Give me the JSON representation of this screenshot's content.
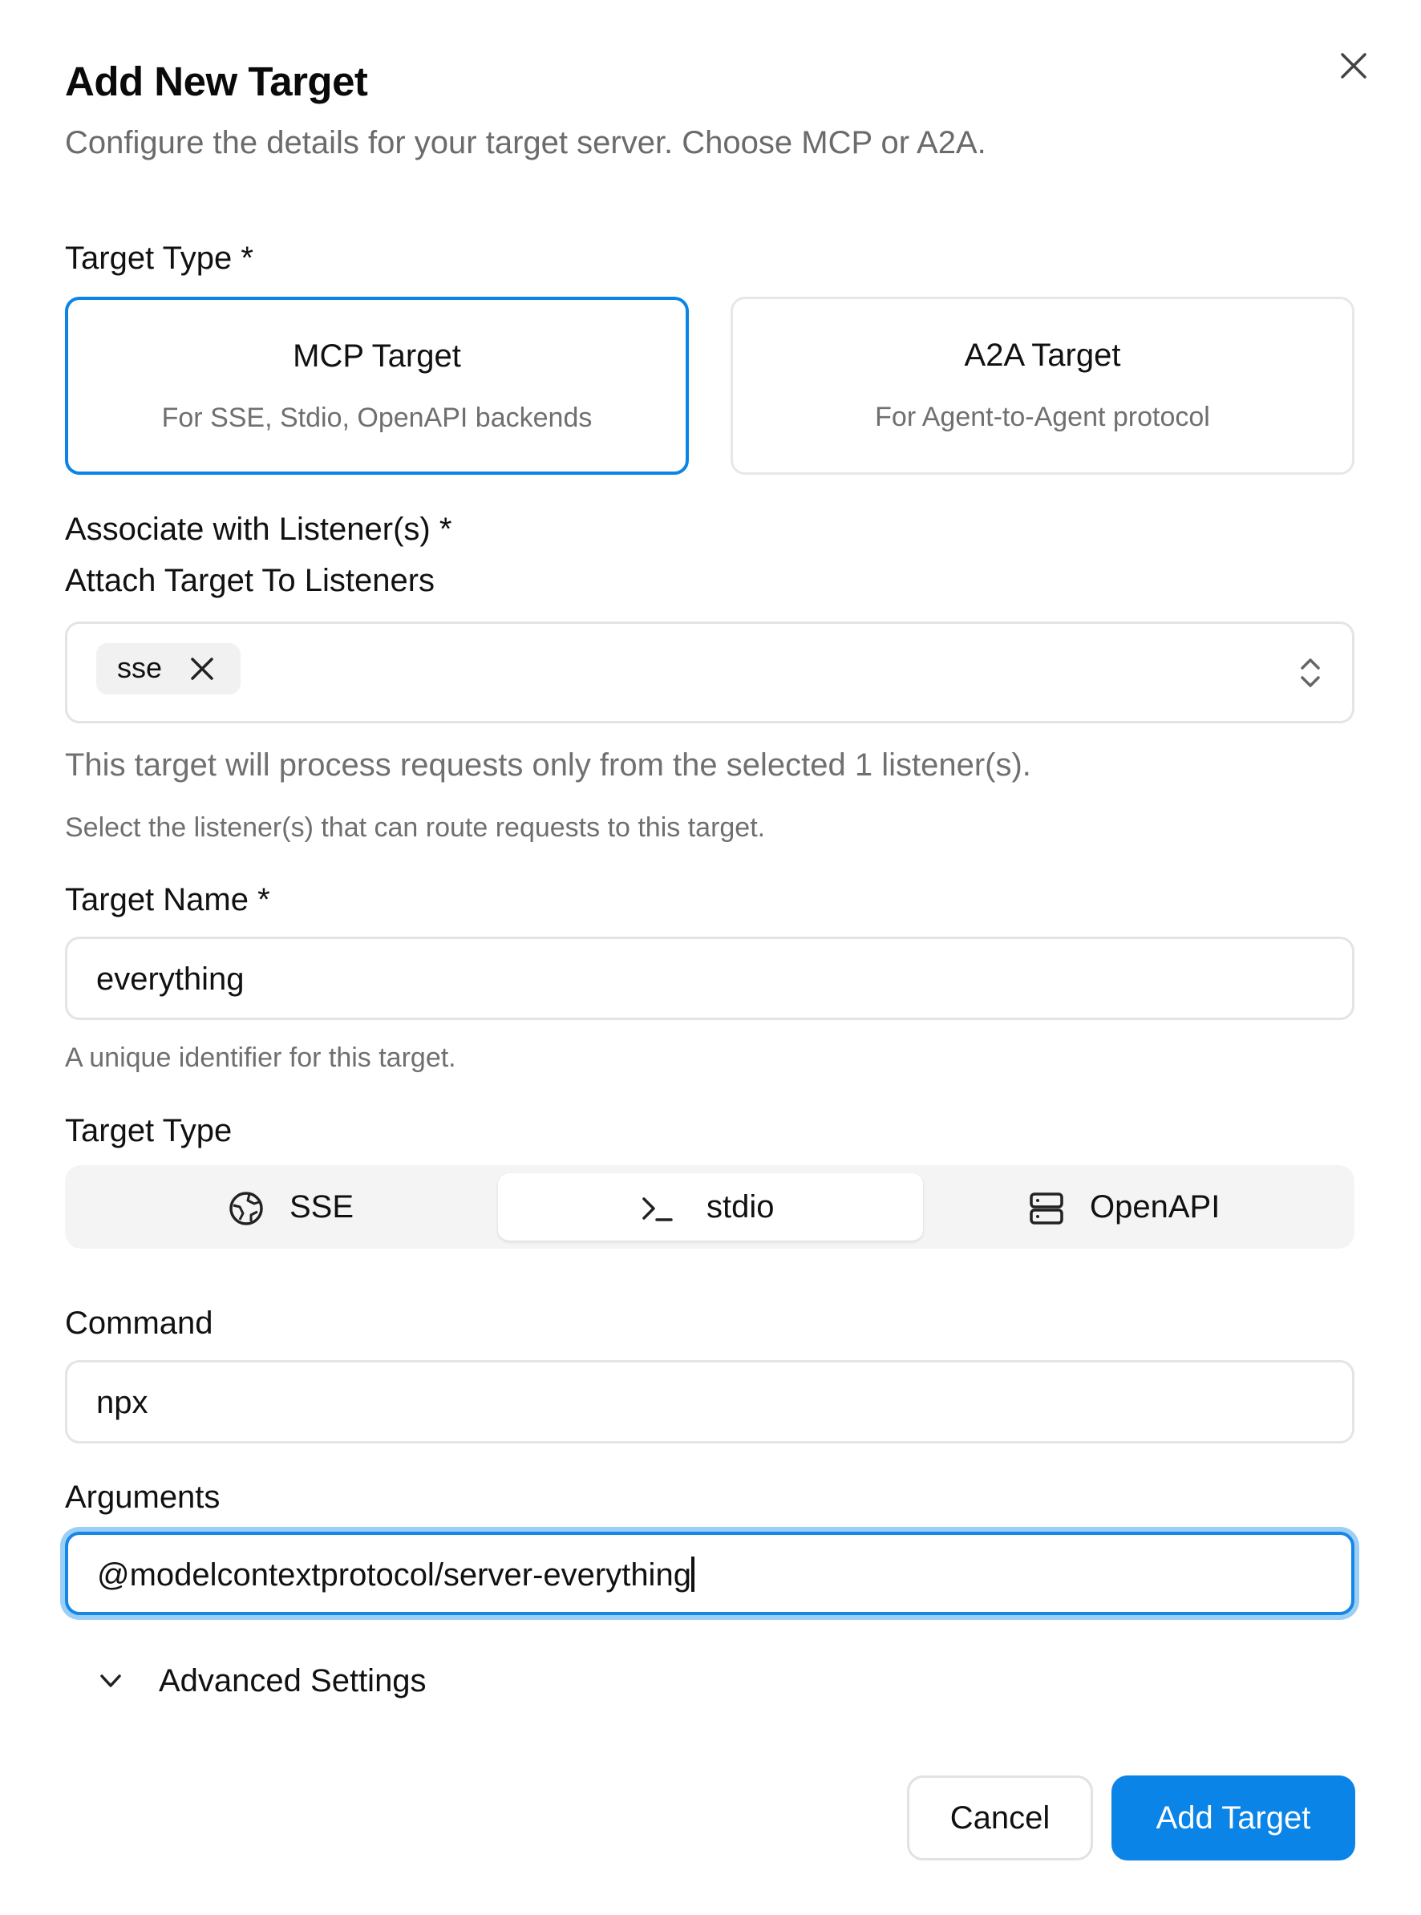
{
  "dialog": {
    "title": "Add New Target",
    "subtitle": "Configure the details for your target server. Choose MCP or A2A.",
    "close_icon": "close-icon"
  },
  "target_type_section": {
    "label": "Target Type *",
    "options": [
      {
        "title": "MCP Target",
        "description": "For SSE, Stdio, OpenAPI backends",
        "selected": true
      },
      {
        "title": "A2A Target",
        "description": "For Agent-to-Agent protocol",
        "selected": false
      }
    ]
  },
  "listeners": {
    "label": "Associate with Listener(s) *",
    "sublabel": "Attach Target To Listeners",
    "selected_chips": [
      "sse"
    ],
    "info_text": "This target will process requests only from the selected 1 listener(s).",
    "help_text": "Select the listener(s) that can route requests to this target."
  },
  "target_name": {
    "label": "Target Name *",
    "value": "everything",
    "help_text": "A unique identifier for this target."
  },
  "transport": {
    "label": "Target Type",
    "options": [
      {
        "label": "SSE",
        "icon": "globe-icon",
        "active": false
      },
      {
        "label": "stdio",
        "icon": "terminal-icon",
        "active": true
      },
      {
        "label": "OpenAPI",
        "icon": "server-icon",
        "active": false
      }
    ]
  },
  "command": {
    "label": "Command",
    "value": "npx"
  },
  "arguments": {
    "label": "Arguments",
    "value": "@modelcontextprotocol/server-everything"
  },
  "advanced": {
    "label": "Advanced Settings",
    "icon": "chevron-down-icon"
  },
  "actions": {
    "cancel_label": "Cancel",
    "submit_label": "Add Target"
  },
  "colors": {
    "accent": "#0a84e6",
    "focus_ring": "#9ccff6",
    "muted_text": "#6f6f6f"
  }
}
